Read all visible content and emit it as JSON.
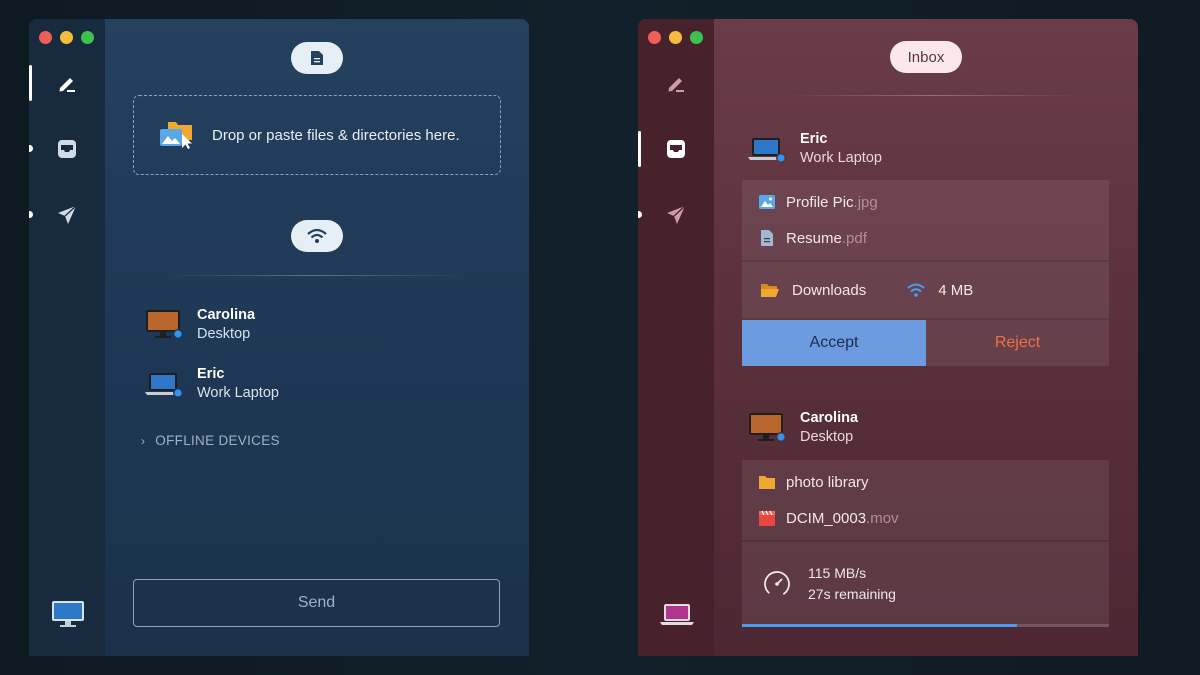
{
  "left_window": {
    "dropzone_text": "Drop or paste files & directories here.",
    "devices": [
      {
        "name": "Carolina",
        "type": "Desktop"
      },
      {
        "name": "Eric",
        "type": "Work Laptop"
      }
    ],
    "offline_label": "OFFLINE DEVICES",
    "send_label": "Send"
  },
  "right_window": {
    "title": "Inbox",
    "transfers": [
      {
        "sender": {
          "name": "Eric",
          "type": "Work Laptop"
        },
        "files": [
          {
            "base": "Profile Pic",
            "ext": ".jpg"
          },
          {
            "base": "Resume",
            "ext": ".pdf"
          }
        ],
        "folder": "Downloads",
        "size": "4 MB",
        "accept_label": "Accept",
        "reject_label": "Reject"
      },
      {
        "sender": {
          "name": "Carolina",
          "type": "Desktop"
        },
        "files": [
          {
            "base": "photo library",
            "ext": ""
          },
          {
            "base": "DCIM_0003",
            "ext": ".mov"
          }
        ],
        "speed": "115 MB/s",
        "remaining": "27s remaining",
        "progress": 0.75
      }
    ]
  },
  "colors": {
    "accent_blue": "#4a9cf2",
    "accept_bg": "#6d9be0",
    "reject_text": "#f07042"
  }
}
